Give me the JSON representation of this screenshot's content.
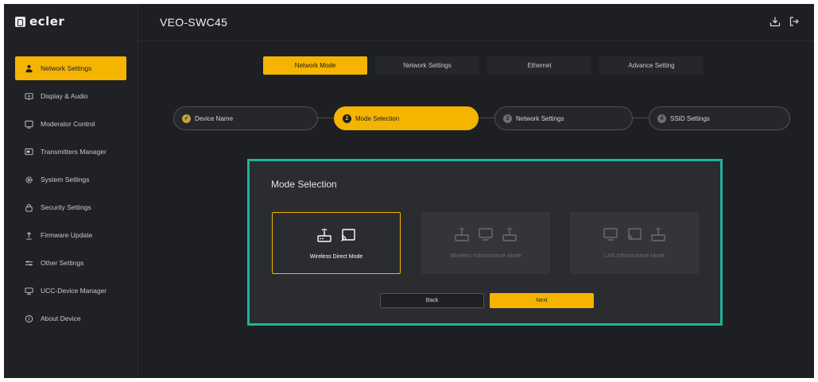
{
  "app": {
    "brand": "ecler",
    "device_title": "VEO-SWC45"
  },
  "colors": {
    "accent": "#f4b400",
    "highlight_border": "#1fb39a",
    "background": "#1d1f22"
  },
  "sidebar": {
    "items": [
      {
        "label": "Network Settings",
        "icon": "person-network-icon",
        "active": true
      },
      {
        "label": "Display & Audio",
        "icon": "display-audio-icon",
        "active": false
      },
      {
        "label": "Moderator Control",
        "icon": "monitor-icon",
        "active": false
      },
      {
        "label": "Transmitters Manager",
        "icon": "transmitter-icon",
        "active": false
      },
      {
        "label": "System Settings",
        "icon": "gear-icon",
        "active": false
      },
      {
        "label": "Security Settings",
        "icon": "lock-icon",
        "active": false
      },
      {
        "label": "Firmware Update",
        "icon": "upload-icon",
        "active": false
      },
      {
        "label": "Other Settings",
        "icon": "sliders-icon",
        "active": false
      },
      {
        "label": "UCC-Device Manager",
        "icon": "device-icon",
        "active": false
      },
      {
        "label": "About Device",
        "icon": "info-icon",
        "active": false
      }
    ]
  },
  "header": {
    "icons": [
      "download-icon",
      "logout-icon"
    ]
  },
  "tabs": [
    {
      "label": "Network Mode",
      "active": true
    },
    {
      "label": "Network Settings",
      "active": false
    },
    {
      "label": "Ethernet",
      "active": false
    },
    {
      "label": "Advance Setting",
      "active": false
    }
  ],
  "steps": [
    {
      "label": "Device Name",
      "marker": "✓",
      "state": "done"
    },
    {
      "label": "Mode Selection",
      "marker": "2",
      "state": "active"
    },
    {
      "label": "Network Settings",
      "marker": "3",
      "state": "todo"
    },
    {
      "label": "SSID Settings",
      "marker": "4",
      "state": "todo"
    }
  ],
  "panel": {
    "title": "Mode Selection",
    "modes": [
      {
        "label": "Wireless Direct Mode",
        "selected": true,
        "icons": [
          "router-icon",
          "cast-icon"
        ]
      },
      {
        "label": "Wireless Infrastructure Mode",
        "selected": false,
        "icons": [
          "router-icon",
          "monitor-icon",
          "router-icon"
        ]
      },
      {
        "label": "LAN Infrastructure Mode",
        "selected": false,
        "icons": [
          "monitor-icon",
          "cast-icon",
          "router-icon"
        ]
      }
    ],
    "back_label": "Back",
    "next_label": "Next"
  }
}
